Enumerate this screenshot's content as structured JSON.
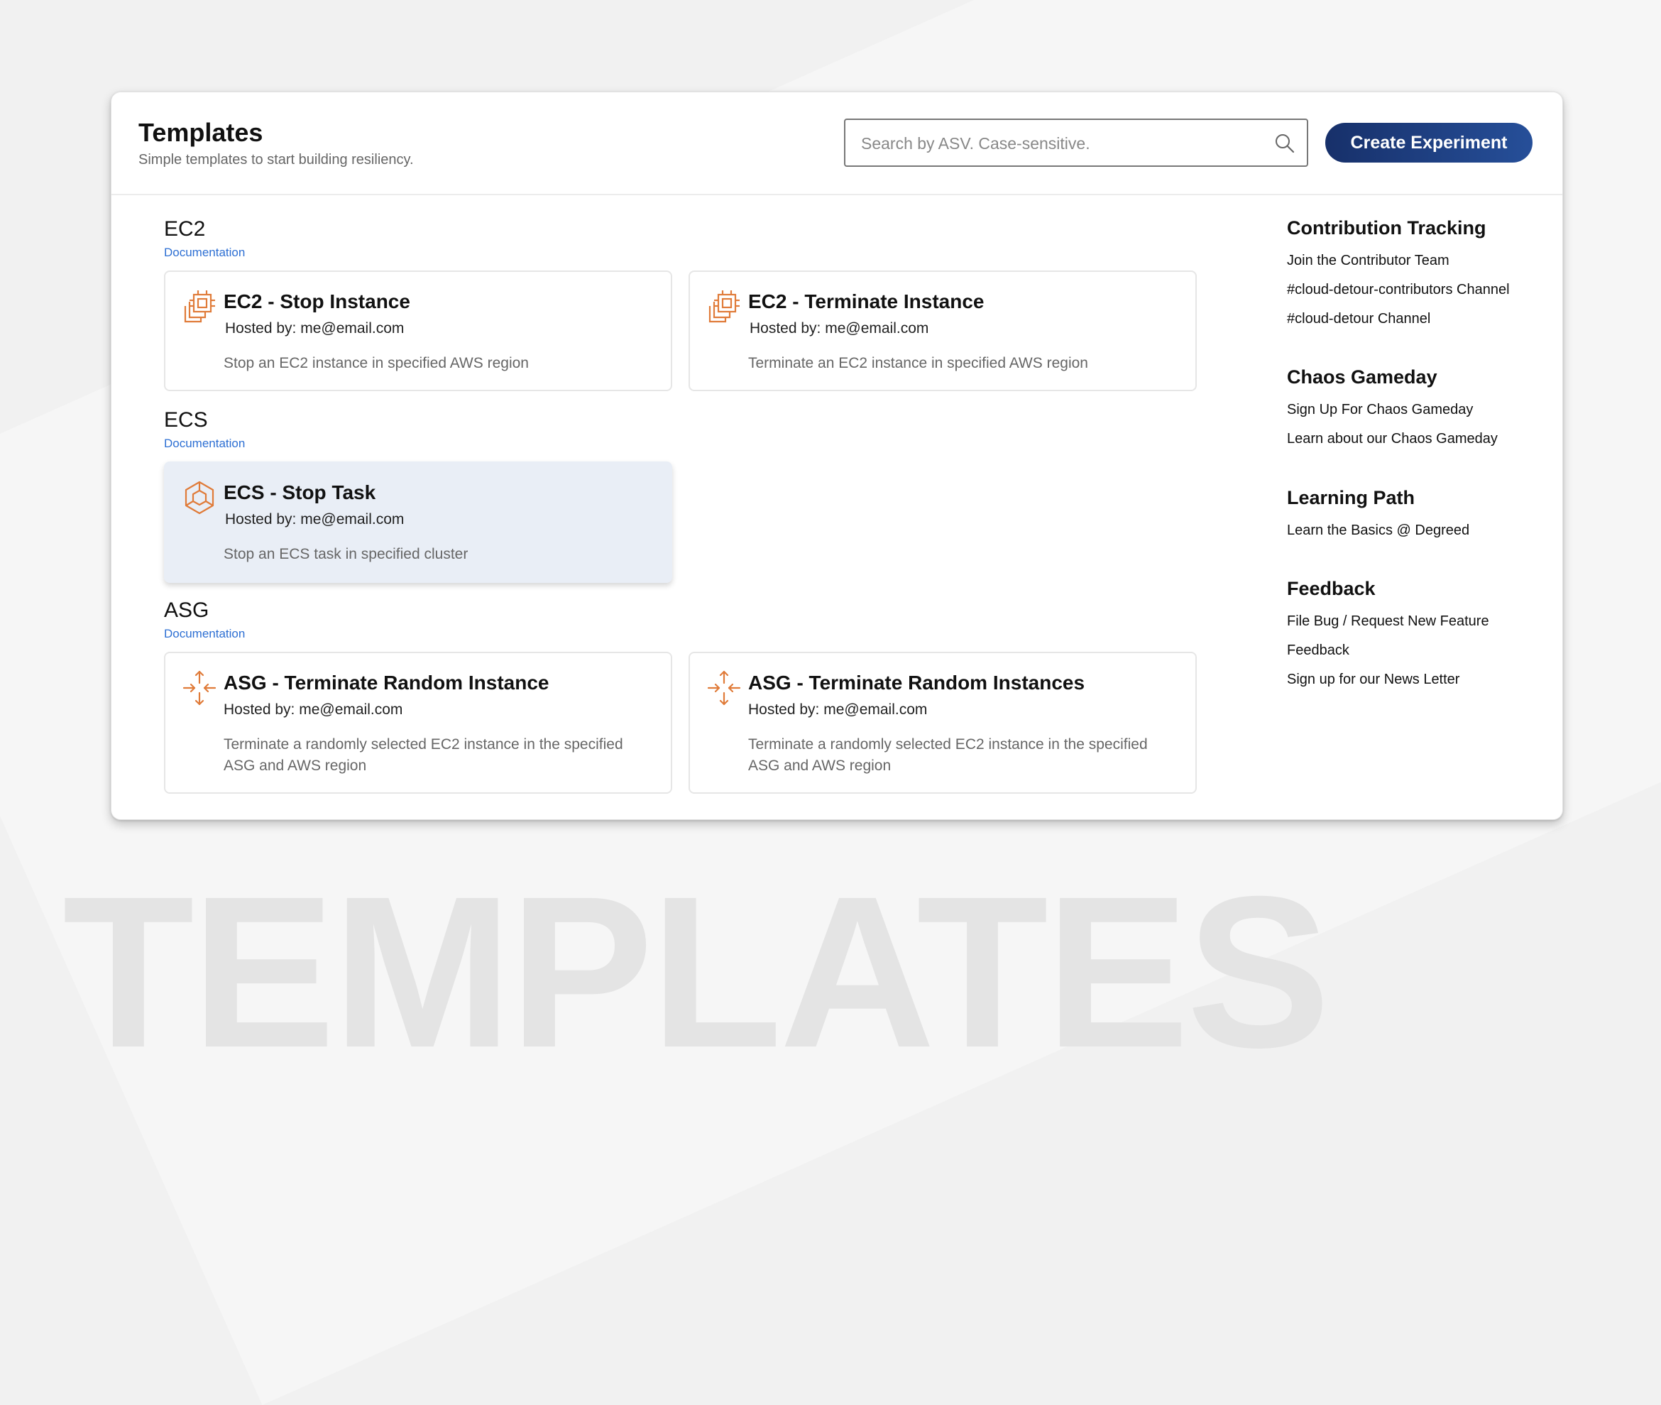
{
  "header": {
    "title": "Templates",
    "subtitle": "Simple templates to start building resiliency.",
    "search_placeholder": "Search by ASV. Case-sensitive.",
    "create_label": "Create Experiment"
  },
  "sections": [
    {
      "title": "EC2",
      "doc_label": "Documentation",
      "cards": [
        {
          "title": "EC2 - Stop Instance",
          "host": "Hosted by: me@email.com",
          "desc": "Stop an EC2 instance in specified AWS region",
          "icon": "chip-icon"
        },
        {
          "title": "EC2 - Terminate Instance",
          "host": "Hosted by: me@email.com",
          "desc": "Terminate an EC2 instance in specified AWS region",
          "icon": "chip-icon"
        }
      ]
    },
    {
      "title": "ECS",
      "doc_label": "Documentation",
      "cards": [
        {
          "title": "ECS - Stop Task",
          "host": "Hosted by: me@email.com",
          "desc": "Stop an ECS task in specified cluster",
          "icon": "hexagon-icon",
          "selected": true
        }
      ]
    },
    {
      "title": "ASG",
      "doc_label": "Documentation",
      "cards": [
        {
          "title": "ASG - Terminate Random Instance",
          "host": "Hosted by: me@email.com",
          "desc": "Terminate a randomly selected EC2 instance in the specified ASG and AWS region",
          "icon": "scale-arrows-icon"
        },
        {
          "title": "ASG - Terminate Random Instances",
          "host": "Hosted by: me@email.com",
          "desc": "Terminate a randomly selected EC2 instance in the specified ASG and AWS region",
          "icon": "scale-arrows-icon"
        }
      ]
    }
  ],
  "sidebar": [
    {
      "title": "Contribution Tracking",
      "links": [
        "Join the Contributor Team",
        "#cloud-detour-contributors Channel",
        "#cloud-detour Channel"
      ]
    },
    {
      "title": "Chaos Gameday",
      "links": [
        "Sign Up For Chaos Gameday",
        "Learn about our Chaos Gameday"
      ]
    },
    {
      "title": "Learning Path",
      "links": [
        "Learn the Basics @ Degreed"
      ]
    },
    {
      "title": "Feedback",
      "links": [
        "File Bug / Request New Feature",
        "Feedback",
        "Sign up for our News Letter"
      ]
    }
  ],
  "background_word": "TEMPLATES",
  "colors": {
    "accent": "#1d3c7f",
    "link": "#2d6fd3",
    "icon": "#e07b39",
    "selected_card": "#e9eef6"
  }
}
